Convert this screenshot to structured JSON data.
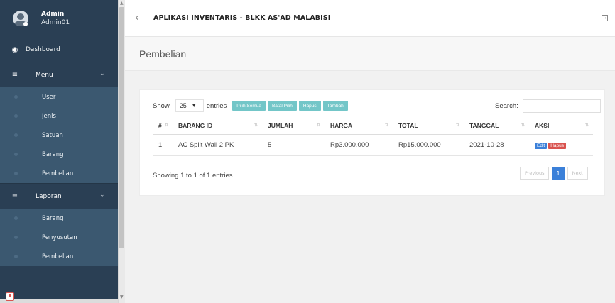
{
  "sidebar": {
    "profile": {
      "name": "Admin",
      "user": "Admin01"
    },
    "dashboard": "Dashboard",
    "menu": {
      "label": "Menu",
      "items": [
        "User",
        "Jenis",
        "Satuan",
        "Barang",
        "Pembelian"
      ]
    },
    "laporan": {
      "label": "Laporan",
      "items": [
        "Barang",
        "Penyusutan",
        "Pembelian"
      ]
    }
  },
  "topnav": {
    "title": "APLIKASI INVENTARIS - BLKK AS'AD MALABISI"
  },
  "page": {
    "title": "Pembelian"
  },
  "toolbar": {
    "show": "Show",
    "length": "25",
    "entries": "entries",
    "buttons": [
      "Pilih Semua",
      "Batal Pilih",
      "Hapus",
      "Tambah"
    ],
    "search_label": "Search:"
  },
  "table": {
    "headers": [
      "#",
      "BARANG ID",
      "JUMLAH",
      "HARGA",
      "TOTAL",
      "TANGGAL",
      "AKSI"
    ],
    "rows": [
      {
        "no": "1",
        "barang": "AC Split Wall 2 PK",
        "jumlah": "5",
        "harga": "Rp3.000.000",
        "total": "Rp15.000.000",
        "tanggal": "2021-10-28",
        "edit": "Edit",
        "hapus": "Hapus"
      }
    ]
  },
  "footer": {
    "info": "Showing 1 to 1 of 1 entries",
    "previous": "Previous",
    "page": "1",
    "next": "Next"
  },
  "colors": {
    "sidebar": "#2a3f54",
    "submenu": "#3b5870",
    "button": "#73c6c8",
    "primary": "#3b80d9",
    "danger": "#d9534f"
  }
}
